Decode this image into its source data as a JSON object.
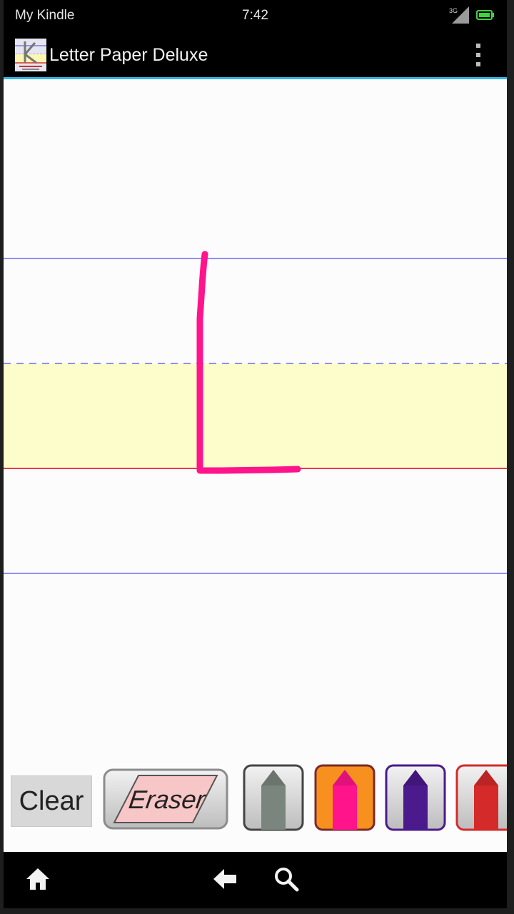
{
  "status_bar": {
    "carrier": "My Kindle",
    "time": "7:42",
    "network": "3G"
  },
  "action_bar": {
    "title": "Letter Paper Deluxe",
    "icon": "letter-paper-app-icon",
    "overflow_icon": "vertical-dots-icon"
  },
  "paper": {
    "guide_colors": {
      "top_line": "#8f8ff0",
      "mid_dashed_line": "#8f8ff0",
      "baseline": "#e8384f",
      "bottom_line": "#8f8ff0",
      "middle_band": "#fdfccb"
    },
    "stroke": {
      "color": "#ff148c",
      "letter": "L"
    }
  },
  "toolbar": {
    "clear_label": "Clear",
    "eraser_label": "Eraser",
    "pens": [
      {
        "name": "gray-pen",
        "color": "#7a857d",
        "selected": false
      },
      {
        "name": "pink-pen",
        "color": "#ff148c",
        "selected": true
      },
      {
        "name": "purple-pen",
        "color": "#4b1a8c",
        "selected": false
      },
      {
        "name": "red-pen",
        "color": "#d42a2a",
        "selected": false
      }
    ]
  },
  "nav_bar": {
    "icons": [
      "home-icon",
      "back-icon",
      "search-icon"
    ]
  }
}
